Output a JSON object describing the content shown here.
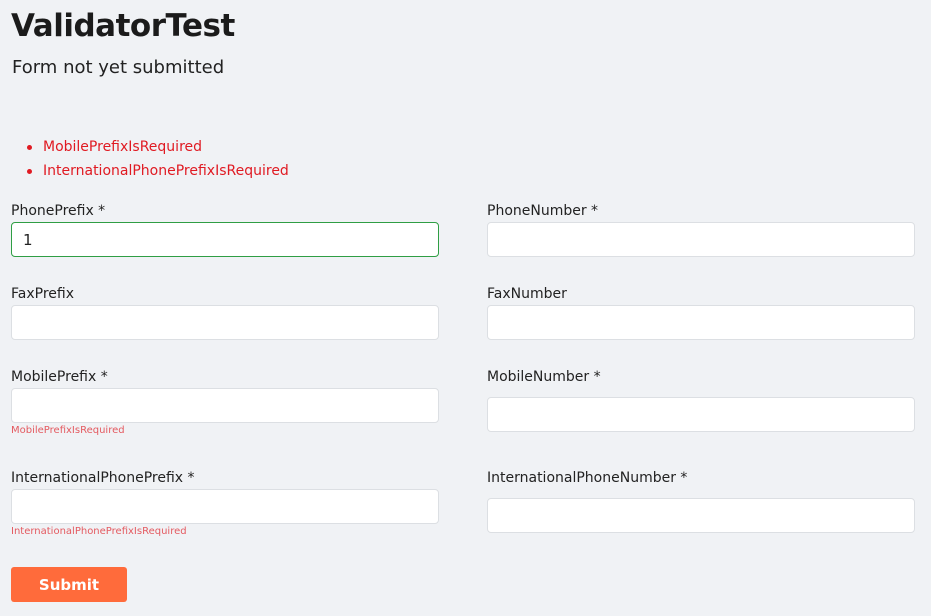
{
  "header": {
    "title": "ValidatorTest",
    "status": "Form not yet submitted"
  },
  "validation_summary": [
    "MobilePrefixIsRequired",
    "InternationalPhonePrefixIsRequired"
  ],
  "fields": {
    "phone_prefix": {
      "label": "PhonePrefix *",
      "value": "1"
    },
    "phone_number": {
      "label": "PhoneNumber *",
      "value": ""
    },
    "fax_prefix": {
      "label": "FaxPrefix",
      "value": ""
    },
    "fax_number": {
      "label": "FaxNumber",
      "value": ""
    },
    "mobile_prefix": {
      "label": "MobilePrefix *",
      "value": "",
      "error": "MobilePrefixIsRequired"
    },
    "mobile_number": {
      "label": "MobileNumber *",
      "value": ""
    },
    "international_phone_prefix": {
      "label": "InternationalPhonePrefix *",
      "value": "",
      "error": "InternationalPhonePrefixIsRequired"
    },
    "international_phone_number": {
      "label": "InternationalPhoneNumber *",
      "value": ""
    }
  },
  "actions": {
    "submit_label": "Submit"
  },
  "colors": {
    "background": "#f0f2f5",
    "error": "#e01a22",
    "field_error": "#e45a60",
    "valid_border": "#2f9e44",
    "submit": "#ff6b3b"
  }
}
